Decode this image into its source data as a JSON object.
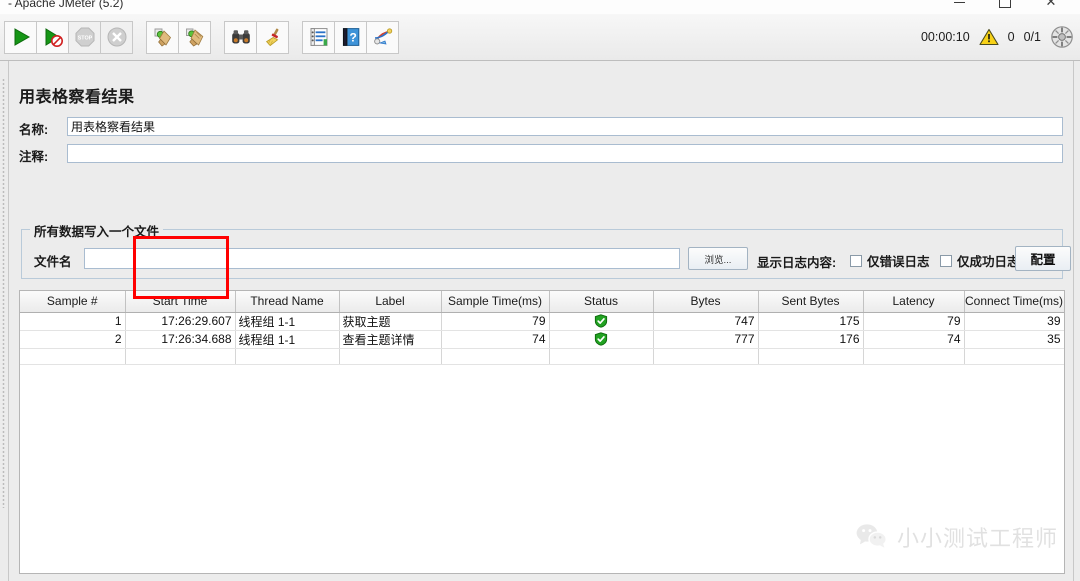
{
  "window": {
    "title": "- Apache JMeter (5.2)",
    "minimize_label": "minimize",
    "maximize_label": "maximize",
    "close_label": "close"
  },
  "toolbar": {
    "buttons": [
      {
        "name": "start-button",
        "icon": "play-green-icon",
        "enabled": true
      },
      {
        "name": "start-no-timers-button",
        "icon": "play-no-timers-icon",
        "enabled": true
      },
      {
        "name": "stop-button",
        "icon": "stop-sign-icon",
        "enabled": false
      },
      {
        "name": "shutdown-button",
        "icon": "shutdown-x-icon",
        "enabled": false
      },
      {
        "name": "clear-button",
        "icon": "clear-broom-icon",
        "enabled": true
      },
      {
        "name": "clear-all-button",
        "icon": "clear-all-broom-icon",
        "enabled": true
      },
      {
        "name": "search-button",
        "icon": "binoculars-icon",
        "enabled": true
      },
      {
        "name": "reset-search-button",
        "icon": "broom-icon",
        "enabled": true
      },
      {
        "name": "function-helper-button",
        "icon": "list-properties-icon",
        "enabled": true
      },
      {
        "name": "help-button",
        "icon": "help-book-icon",
        "enabled": true
      },
      {
        "name": "templates-button",
        "icon": "templates-icon",
        "enabled": true
      }
    ],
    "status": {
      "elapsed_time": "00:00:10",
      "warning_icon": "warning-triangle-icon",
      "warning_count": "0",
      "threads": "0/1",
      "remote_icon": "remote-engines-icon"
    }
  },
  "panel": {
    "title": "用表格察看结果",
    "name_label": "名称:",
    "name_value": "用表格察看结果",
    "comment_label": "注释:",
    "comment_value": "",
    "comment_placeholder": ""
  },
  "file_group": {
    "title": "所有数据写入一个文件",
    "filename_label": "文件名",
    "filename_value": "",
    "browse_label": "浏览...",
    "log_display_label": "显示日志内容:",
    "errors_only_label": "仅错误日志",
    "errors_only_checked": false,
    "successes_only_label": "仅成功日志",
    "successes_only_checked": false,
    "configure_label": "配置"
  },
  "table": {
    "columns": [
      "Sample #",
      "Start Time",
      "Thread Name",
      "Label",
      "Sample Time(ms)",
      "Status",
      "Bytes",
      "Sent Bytes",
      "Latency",
      "Connect Time(ms)"
    ],
    "rows": [
      {
        "sample": "1",
        "start_time": "17:26:29.607",
        "thread_name": "线程组 1-1",
        "label": "获取主题",
        "sample_time": "79",
        "status": "success-shield-icon",
        "bytes": "747",
        "sent_bytes": "175",
        "latency": "79",
        "connect_time": "39"
      },
      {
        "sample": "2",
        "start_time": "17:26:34.688",
        "thread_name": "线程组 1-1",
        "label": "查看主题详情",
        "sample_time": "74",
        "status": "success-shield-icon",
        "bytes": "777",
        "sent_bytes": "176",
        "latency": "74",
        "connect_time": "35"
      }
    ]
  },
  "annotation": {
    "type": "red-rectangle-highlight",
    "target_column": "Start Time",
    "color": "#ff0000"
  },
  "watermark": {
    "icon": "wechat-icon",
    "text": "小小测试工程师"
  },
  "colors": {
    "background": "#ececec",
    "panel_background": "#ececec",
    "field_background": "#ffffff",
    "accent_green": "#2ea12e",
    "annotation_red": "#ff0000",
    "warning_yellow": "#f2c300"
  }
}
